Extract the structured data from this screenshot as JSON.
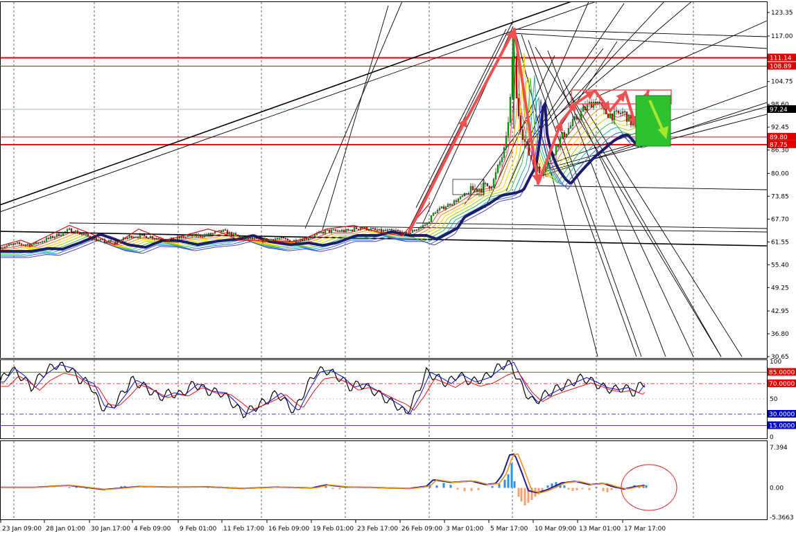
{
  "chart_data": [
    {
      "type": "candlestick",
      "name": "main-price",
      "x_labels": [
        "23 Jan 09:00",
        "28 Jan 01:00",
        "30 Jan 17:00",
        "4 Feb 09:00",
        "9 Feb 01:00",
        "11 Feb 17:00",
        "16 Feb 09:00",
        "19 Feb 01:00",
        "23 Feb 17:00",
        "26 Feb 09:00",
        "3 Mar 01:00",
        "5 Mar 17:00",
        "10 Mar 09:00",
        "13 Mar 01:00",
        "17 Mar 17:00"
      ],
      "y_ticks": [
        "123.35",
        "117.00",
        "111.14",
        "108.89",
        "104.75",
        "98.60",
        "97.24",
        "92.45",
        "89.80",
        "87.75",
        "86.30",
        "80.00",
        "73.85",
        "67.70",
        "61.55",
        "55.40",
        "49.25",
        "42.95",
        "36.80",
        "30.65"
      ],
      "ylim": [
        30.65,
        123.35
      ],
      "current_price": 97.24,
      "horizontal_levels": [
        {
          "value": 111.14,
          "label": "111.14",
          "color": "#e00000"
        },
        {
          "value": 108.89,
          "label": "108.89",
          "color": "#e00000"
        },
        {
          "value": 89.8,
          "label": "89.80",
          "color": "#e00000"
        },
        {
          "value": 87.75,
          "label": "87.75",
          "color": "#e00000"
        },
        {
          "value": 97.24,
          "label": "97.24",
          "color": "#000000"
        }
      ],
      "price_path": [
        [
          0,
          60.2
        ],
        [
          25,
          61.0
        ],
        [
          45,
          60.8
        ],
        [
          70,
          62.5
        ],
        [
          100,
          64.8
        ],
        [
          120,
          63.5
        ],
        [
          140,
          62.0
        ],
        [
          165,
          61.3
        ],
        [
          190,
          63.2
        ],
        [
          215,
          63.0
        ],
        [
          240,
          62.0
        ],
        [
          270,
          63.0
        ],
        [
          300,
          63.5
        ],
        [
          320,
          64.5
        ],
        [
          345,
          62.8
        ],
        [
          375,
          62.0
        ],
        [
          400,
          62.5
        ],
        [
          420,
          61.8
        ],
        [
          440,
          62.5
        ],
        [
          470,
          64.5
        ],
        [
          500,
          64.5
        ],
        [
          520,
          65.5
        ],
        [
          545,
          64.5
        ],
        [
          570,
          64.5
        ],
        [
          585,
          63.5
        ],
        [
          600,
          65.0
        ],
        [
          615,
          66.5
        ],
        [
          625,
          69.5
        ],
        [
          640,
          71.0
        ],
        [
          660,
          73.0
        ],
        [
          680,
          75.5
        ],
        [
          700,
          76.5
        ],
        [
          710,
          77.5
        ],
        [
          720,
          83.0
        ],
        [
          728,
          87.0
        ],
        [
          735,
          100.0
        ],
        [
          740,
          117.0
        ],
        [
          743,
          101.0
        ],
        [
          747,
          96.0
        ],
        [
          752,
          91.0
        ],
        [
          760,
          86.0
        ],
        [
          770,
          82.0
        ],
        [
          778,
          80.0
        ],
        [
          790,
          84.0
        ],
        [
          800,
          87.0
        ],
        [
          812,
          90.5
        ],
        [
          825,
          93.5
        ],
        [
          840,
          97.0
        ],
        [
          852,
          99.0
        ],
        [
          860,
          99.5
        ],
        [
          870,
          96.5
        ],
        [
          885,
          95.5
        ],
        [
          898,
          96.5
        ],
        [
          910,
          93.5
        ],
        [
          918,
          95.0
        ],
        [
          925,
          97.5
        ],
        [
          932,
          99.0
        ]
      ],
      "colors": {
        "background": "#ffffff",
        "bull": "#00b000",
        "bear": "#e00000",
        "ma_dark": "#1c1c6e",
        "arrows": "#f05050",
        "green_box": "#2fc22f"
      }
    },
    {
      "type": "line",
      "name": "stochastic-oscillator",
      "y_ticks": [
        "100",
        "85.0000",
        "70.0000",
        "50",
        "30.0000",
        "15.0000",
        "0"
      ],
      "ylim": [
        0,
        100
      ],
      "levels": [
        85,
        70,
        30,
        15
      ],
      "series_path": [
        [
          0,
          72
        ],
        [
          15,
          90
        ],
        [
          30,
          80
        ],
        [
          45,
          65
        ],
        [
          60,
          82
        ],
        [
          80,
          95
        ],
        [
          100,
          90
        ],
        [
          115,
          75
        ],
        [
          130,
          70
        ],
        [
          145,
          40
        ],
        [
          160,
          38
        ],
        [
          175,
          55
        ],
        [
          190,
          75
        ],
        [
          210,
          65
        ],
        [
          230,
          52
        ],
        [
          245,
          58
        ],
        [
          260,
          55
        ],
        [
          280,
          70
        ],
        [
          300,
          60
        ],
        [
          320,
          58
        ],
        [
          335,
          45
        ],
        [
          350,
          30
        ],
        [
          370,
          40
        ],
        [
          385,
          48
        ],
        [
          400,
          58
        ],
        [
          415,
          42
        ],
        [
          425,
          34
        ],
        [
          440,
          62
        ],
        [
          455,
          85
        ],
        [
          470,
          88
        ],
        [
          490,
          78
        ],
        [
          505,
          65
        ],
        [
          520,
          70
        ],
        [
          540,
          60
        ],
        [
          560,
          48
        ],
        [
          575,
          40
        ],
        [
          585,
          30
        ],
        [
          600,
          55
        ],
        [
          615,
          85
        ],
        [
          630,
          78
        ],
        [
          645,
          70
        ],
        [
          660,
          82
        ],
        [
          680,
          72
        ],
        [
          700,
          78
        ],
        [
          720,
          92
        ],
        [
          735,
          98
        ],
        [
          745,
          80
        ],
        [
          755,
          62
        ],
        [
          770,
          45
        ],
        [
          785,
          55
        ],
        [
          800,
          62
        ],
        [
          820,
          70
        ],
        [
          840,
          78
        ],
        [
          855,
          72
        ],
        [
          870,
          65
        ],
        [
          885,
          62
        ],
        [
          900,
          65
        ],
        [
          915,
          58
        ],
        [
          925,
          70
        ],
        [
          932,
          72
        ]
      ],
      "colors": {
        "main": "#000000",
        "signal": "#1010d0",
        "third": "#e00000",
        "level_red": "#e00000",
        "level_blue": "#0000c0"
      }
    },
    {
      "type": "bar",
      "name": "momentum-histogram",
      "y_ticks": [
        "7.394",
        "0.00",
        "-5.3663"
      ],
      "ylim": [
        -5.3663,
        7.394
      ],
      "histogram": [
        [
          100,
          0.15
        ],
        [
          110,
          0.2
        ],
        [
          125,
          -0.2
        ],
        [
          175,
          0.3
        ],
        [
          180,
          0.35
        ],
        [
          300,
          0.2
        ],
        [
          460,
          0.25
        ],
        [
          470,
          0.3
        ],
        [
          480,
          -0.2
        ],
        [
          490,
          -0.25
        ],
        [
          520,
          0.2
        ],
        [
          590,
          -0.2
        ],
        [
          610,
          0.3
        ],
        [
          620,
          0.6
        ],
        [
          630,
          0.45
        ],
        [
          640,
          0.9
        ],
        [
          650,
          0.55
        ],
        [
          660,
          -0.3
        ],
        [
          670,
          -0.6
        ],
        [
          680,
          -0.55
        ],
        [
          690,
          -0.4
        ],
        [
          710,
          0.35
        ],
        [
          720,
          0.7
        ],
        [
          728,
          1.5
        ],
        [
          733,
          2.5
        ],
        [
          738,
          4.5
        ],
        [
          742,
          1.2
        ],
        [
          748,
          -1.6
        ],
        [
          752,
          -2.5
        ],
        [
          757,
          -3.2
        ],
        [
          762,
          -2.7
        ],
        [
          767,
          -2.2
        ],
        [
          772,
          -1.6
        ],
        [
          777,
          -1.2
        ],
        [
          782,
          -0.6
        ],
        [
          790,
          0.45
        ],
        [
          796,
          0.8
        ],
        [
          802,
          1.05
        ],
        [
          808,
          0.8
        ],
        [
          814,
          0.45
        ],
        [
          820,
          -0.3
        ],
        [
          826,
          -0.55
        ],
        [
          832,
          -0.45
        ],
        [
          840,
          -0.25
        ],
        [
          850,
          -0.4
        ],
        [
          860,
          0.2
        ],
        [
          870,
          -0.6
        ],
        [
          876,
          -0.8
        ],
        [
          882,
          -0.4
        ],
        [
          888,
          0.2
        ],
        [
          900,
          -0.2
        ],
        [
          915,
          0.5
        ],
        [
          922,
          0.4
        ],
        [
          928,
          0.6
        ],
        [
          932,
          0.5
        ]
      ],
      "line_path": [
        [
          0,
          0.1
        ],
        [
          50,
          0.1
        ],
        [
          100,
          0.45
        ],
        [
          150,
          -0.3
        ],
        [
          200,
          0.25
        ],
        [
          250,
          0.15
        ],
        [
          300,
          0.2
        ],
        [
          350,
          -0.1
        ],
        [
          400,
          0.15
        ],
        [
          450,
          0.0
        ],
        [
          470,
          0.55
        ],
        [
          500,
          0.15
        ],
        [
          530,
          0.1
        ],
        [
          590,
          -0.1
        ],
        [
          615,
          0.3
        ],
        [
          625,
          1.5
        ],
        [
          650,
          1.0
        ],
        [
          680,
          1.25
        ],
        [
          700,
          0.6
        ],
        [
          715,
          0.8
        ],
        [
          725,
          2.5
        ],
        [
          735,
          6.0
        ],
        [
          742,
          6.2
        ],
        [
          752,
          3.0
        ],
        [
          762,
          -0.5
        ],
        [
          775,
          -0.9
        ],
        [
          790,
          -0.3
        ],
        [
          810,
          0.9
        ],
        [
          830,
          1.2
        ],
        [
          850,
          0.6
        ],
        [
          870,
          0.8
        ],
        [
          885,
          0.2
        ],
        [
          900,
          -0.2
        ],
        [
          915,
          0.2
        ],
        [
          932,
          0.5
        ]
      ],
      "colors": {
        "bars_up": "#3090e0",
        "bars_down": "#f4a070",
        "line_a": "#1c1c8e",
        "line_b": "#f09020",
        "ellipse": "#e04040"
      }
    }
  ]
}
